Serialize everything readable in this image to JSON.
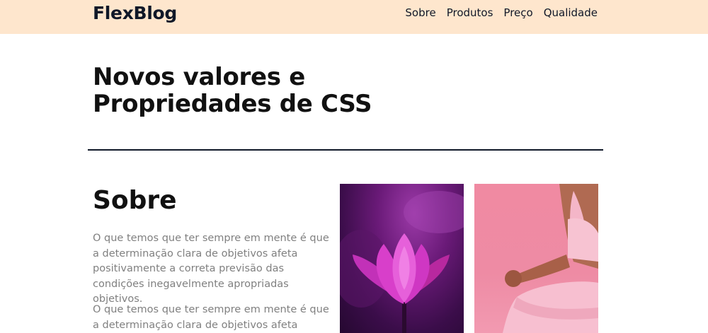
{
  "header": {
    "logo": "FlexBlog",
    "nav": [
      {
        "label": "Sobre"
      },
      {
        "label": "Produtos"
      },
      {
        "label": "Preço"
      },
      {
        "label": "Qualidade"
      }
    ]
  },
  "hero": {
    "title_line1": "Novos valores e",
    "title_line2": "Propriedades de CSS"
  },
  "about": {
    "title": "Sobre",
    "paragraphs": [
      "O que temos que ter sempre em mente é que a determinação clara de objetivos afeta positivamente a correta previsão das condições inegavelmente apropriadas objetivos.",
      "O que temos que ter sempre em mente é que a determinação clara de objetivos afeta"
    ]
  },
  "colors": {
    "header_bg": "#fee6cd",
    "text_dark": "#111827",
    "text_muted": "#808080"
  }
}
